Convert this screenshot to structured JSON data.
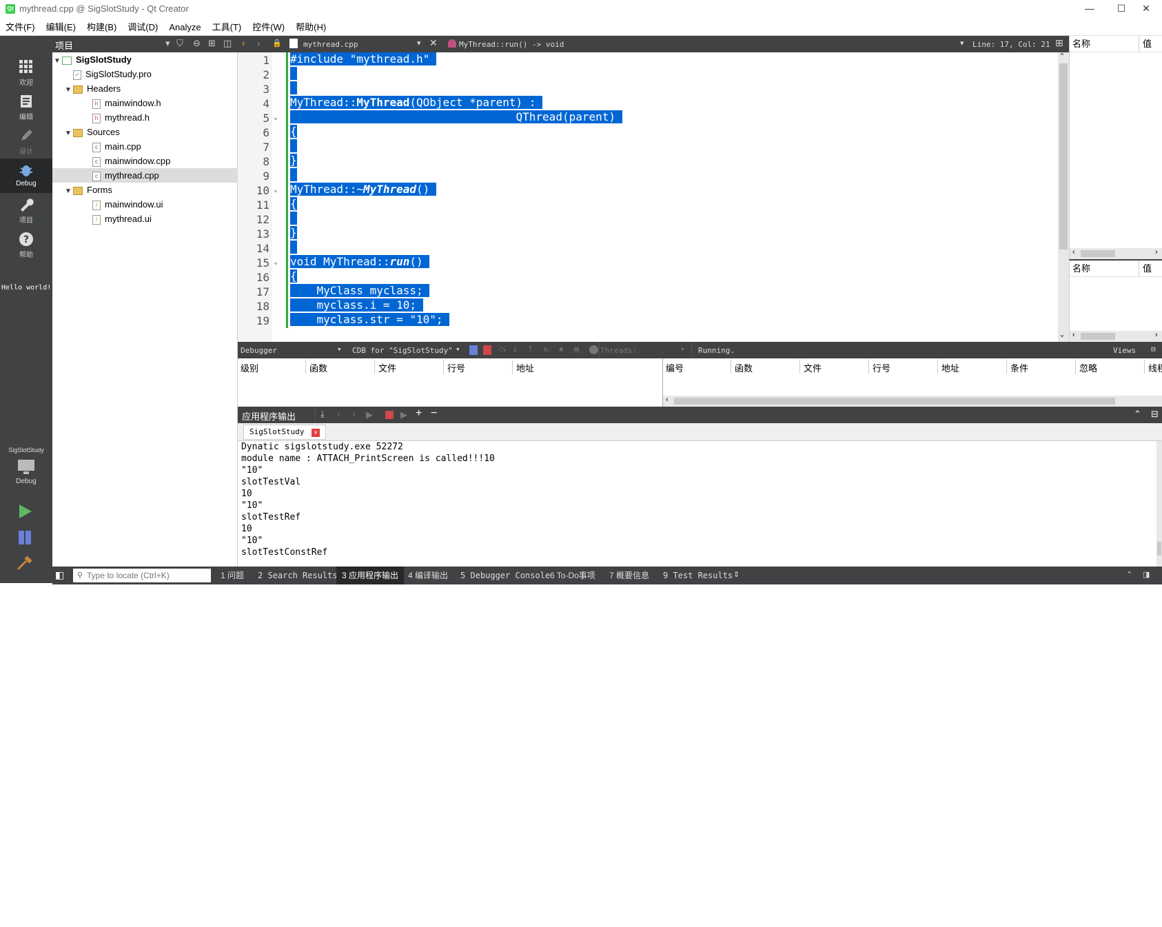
{
  "window": {
    "title": "mythread.cpp @ SigSlotStudy - Qt Creator",
    "logo": "Qt"
  },
  "menu": [
    "文件(F)",
    "编辑(E)",
    "构建(B)",
    "调试(D)",
    "Analyze",
    "工具(T)",
    "控件(W)",
    "帮助(H)"
  ],
  "modes": [
    {
      "label": "欢迎",
      "icon": "grid-icon"
    },
    {
      "label": "编辑",
      "icon": "document-icon"
    },
    {
      "label": "设计",
      "icon": "pencil-icon"
    },
    {
      "label": "Debug",
      "icon": "bug-icon"
    },
    {
      "label": "项目",
      "icon": "wrench-icon"
    },
    {
      "label": "帮助",
      "icon": "help-icon"
    }
  ],
  "hello": "Hello world!",
  "kit": {
    "project": "SigSlotStudy",
    "label": "Debug"
  },
  "project": {
    "header": "项目",
    "tree": [
      {
        "label": "SigSlotStudy",
        "level": 0,
        "bold": true
      },
      {
        "label": "SigSlotStudy.pro",
        "level": 1
      },
      {
        "label": "Headers",
        "level": 1,
        "folder": true
      },
      {
        "label": "mainwindow.h",
        "level": 2
      },
      {
        "label": "mythread.h",
        "level": 2
      },
      {
        "label": "Sources",
        "level": 1,
        "folder": true
      },
      {
        "label": "main.cpp",
        "level": 2
      },
      {
        "label": "mainwindow.cpp",
        "level": 2
      },
      {
        "label": "mythread.cpp",
        "level": 2,
        "selected": true
      },
      {
        "label": "Forms",
        "level": 1,
        "folder": true
      },
      {
        "label": "mainwindow.ui",
        "level": 2
      },
      {
        "label": "mythread.ui",
        "level": 2
      }
    ]
  },
  "editor": {
    "file": "mythread.cpp",
    "symbol": "MyThread::run() -> void",
    "position": "Line: 17, Col: 21"
  },
  "right_panels": {
    "name": "名称",
    "value": "值"
  },
  "debugger": {
    "label": "Debugger",
    "engine": "CDB for \"SigSlotStudy\"",
    "threads": "Threads:",
    "status": "Running.",
    "views": "Views",
    "stack_cols": [
      "级别",
      "函数",
      "文件",
      "行号",
      "地址"
    ],
    "bp_cols": [
      "编号",
      "函数",
      "文件",
      "行号",
      "地址",
      "条件",
      "忽略",
      "线程"
    ]
  },
  "output": {
    "header": "应用程序输出",
    "tab": "SigSlotStudy",
    "lines": [
      "Dynatic sigslotstudy.exe 52272",
      "module name : ATTACH_PrintScreen is called!!!10",
      "\"10\"",
      "slotTestVal",
      "10",
      "\"10\"",
      "slotTestRef",
      "10",
      "\"10\"",
      "slotTestConstRef"
    ]
  },
  "status": {
    "locate_placeholder": "Type to locate (Ctrl+K)",
    "tabs": [
      "1 问题",
      "2 Search Results",
      "3 应用程序输出",
      "4 编译输出",
      "5 Debugger Console",
      "6 To-Do事项",
      "7 概要信息",
      "9 Test Results"
    ]
  },
  "colors": {
    "selection": "#0066d4",
    "sidebar": "#404244",
    "active_mode": "#262829"
  }
}
